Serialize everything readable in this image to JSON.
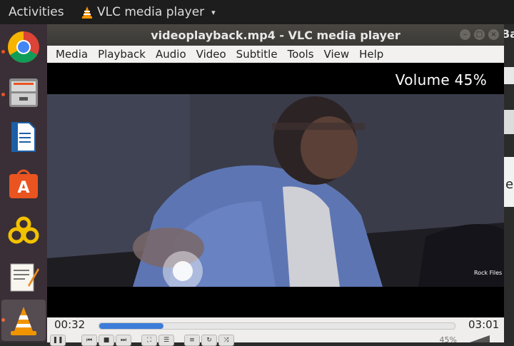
{
  "topbar": {
    "activities": "Activities",
    "app_name": "VLC media player",
    "caret": "▾"
  },
  "dock": {
    "items": [
      "chrome-icon",
      "files-icon",
      "writer-icon",
      "software-center-icon",
      "settings-icon",
      "text-editor-icon",
      "vlc-icon"
    ]
  },
  "window": {
    "title": "videoplayback.mp4 - VLC media player"
  },
  "menu": {
    "items": [
      "Media",
      "Playback",
      "Audio",
      "Video",
      "Subtitle",
      "Tools",
      "View",
      "Help"
    ]
  },
  "video": {
    "osd": "Volume 45%",
    "watermark": "Rock Files"
  },
  "playback": {
    "elapsed": "00:32",
    "total": "03:01",
    "progress_fraction": 0.18,
    "volume_percent": 45,
    "volume_label": "45%"
  },
  "bg_window": {
    "partial_text": "e",
    "title_fragment": "Ba"
  },
  "colors": {
    "accent": "#3b7dd8",
    "ubuntu_orange": "#e95420",
    "dock_bg": "#3a2f36"
  }
}
